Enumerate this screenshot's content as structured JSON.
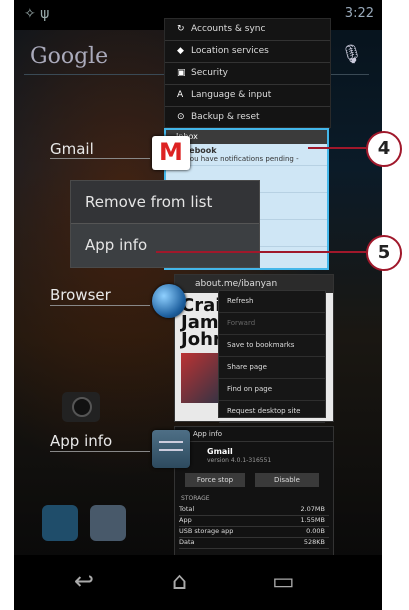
{
  "status_bar": {
    "time": "3:22"
  },
  "search": {
    "logo": "Google",
    "mic_icon": "microphone-icon"
  },
  "settings_card": {
    "items": [
      {
        "label": "Accounts & sync",
        "icon": "sync-icon"
      },
      {
        "label": "Location services",
        "icon": "location-icon"
      },
      {
        "label": "Security",
        "icon": "lock-icon"
      },
      {
        "label": "Language & input",
        "icon": "keyboard-icon"
      },
      {
        "label": "Backup & reset",
        "icon": "backup-icon"
      }
    ]
  },
  "recent_apps": [
    {
      "label": "Gmail"
    },
    {
      "label": "Browser"
    },
    {
      "label": "App info"
    }
  ],
  "gmail_card": {
    "header": "Inbox",
    "messages": [
      {
        "from": "Facebook",
        "snippet": "Hi, you have notifications pending -"
      },
      {
        "from": "",
        "snippet": ""
      },
      {
        "from": "",
        "snippet": ""
      }
    ]
  },
  "context_menu": {
    "items": [
      {
        "label": "Remove from list"
      },
      {
        "label": "App info"
      }
    ]
  },
  "browser_card": {
    "url": "about.me/ibanyan",
    "page_lines": [
      "Craig",
      "James",
      "Johnsto"
    ],
    "menu": [
      "Refresh",
      "Forward",
      "Save to bookmarks",
      "Share page",
      "Find on page",
      "Request desktop site"
    ]
  },
  "appinfo_card": {
    "header": "App info",
    "app_name": "Gmail",
    "version": "version 4.0.1-316551",
    "force_stop": "Force stop",
    "disable": "Disable",
    "section": "STORAGE",
    "storage": [
      {
        "label": "Total",
        "value": "2.07MB"
      },
      {
        "label": "App",
        "value": "1.55MB"
      },
      {
        "label": "USB storage app",
        "value": "0.00B"
      },
      {
        "label": "Data",
        "value": "528KB"
      }
    ]
  },
  "callouts": {
    "c4": "4",
    "c5": "5"
  },
  "colors": {
    "accent": "#33b5e5",
    "callout": "#a0182b"
  }
}
